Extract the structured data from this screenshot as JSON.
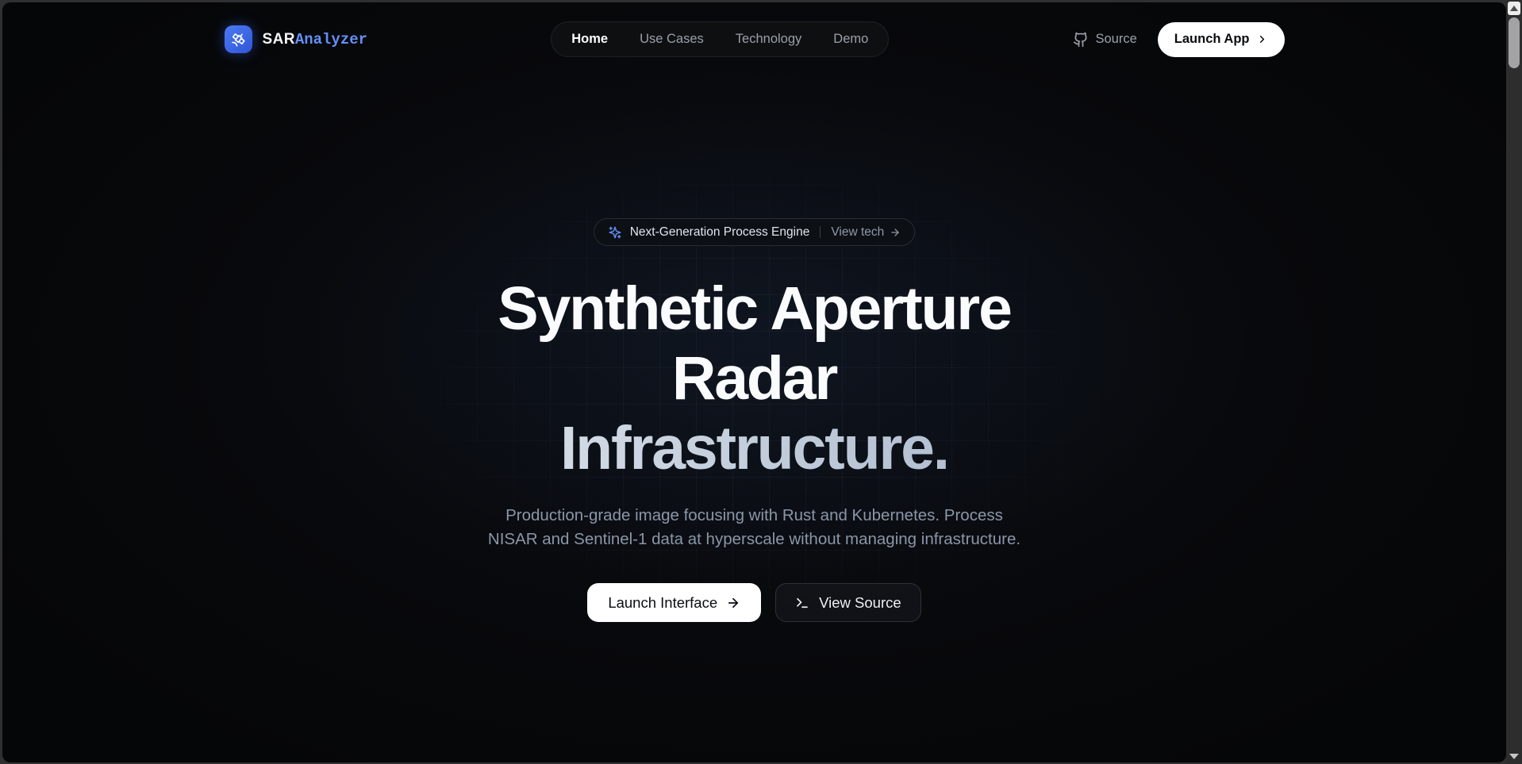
{
  "header": {
    "brand": {
      "primary": "SAR",
      "secondary": "Analyzer"
    },
    "nav": [
      {
        "label": "Home",
        "active": true
      },
      {
        "label": "Use Cases",
        "active": false
      },
      {
        "label": "Technology",
        "active": false
      },
      {
        "label": "Demo",
        "active": false
      }
    ],
    "source_label": "Source",
    "launch_app_label": "Launch App"
  },
  "hero": {
    "badge": {
      "label": "Next-Generation Process Engine",
      "link_label": "View tech"
    },
    "title": {
      "line1": "Synthetic Aperture",
      "line2": "Radar",
      "line3": "Infrastructure."
    },
    "subtitle": {
      "line1": "Production-grade image focusing with Rust and Kubernetes. Process",
      "line2": "NISAR and Sentinel-1 data at hyperscale without managing infrastructure."
    },
    "cta": {
      "primary_label": "Launch Interface",
      "secondary_label": "View Source"
    }
  },
  "icons": {
    "logo": "satellite",
    "badge": "sparkles",
    "source": "github",
    "view_tech_arrow": "arrow-right",
    "primary_cta_arrow": "arrow-right",
    "secondary_cta": "terminal",
    "launch_app_chevron": "chevron-right"
  },
  "colors": {
    "accent_blue": "#4c7af3",
    "brand_text_blue": "#6490f5",
    "badge_icon_blue": "#5f8cf2",
    "page_background": "#08090c",
    "primary_button": "#ffffff",
    "muted_text": "#8b96a7",
    "title_gradient_end": "#8da1bb"
  }
}
